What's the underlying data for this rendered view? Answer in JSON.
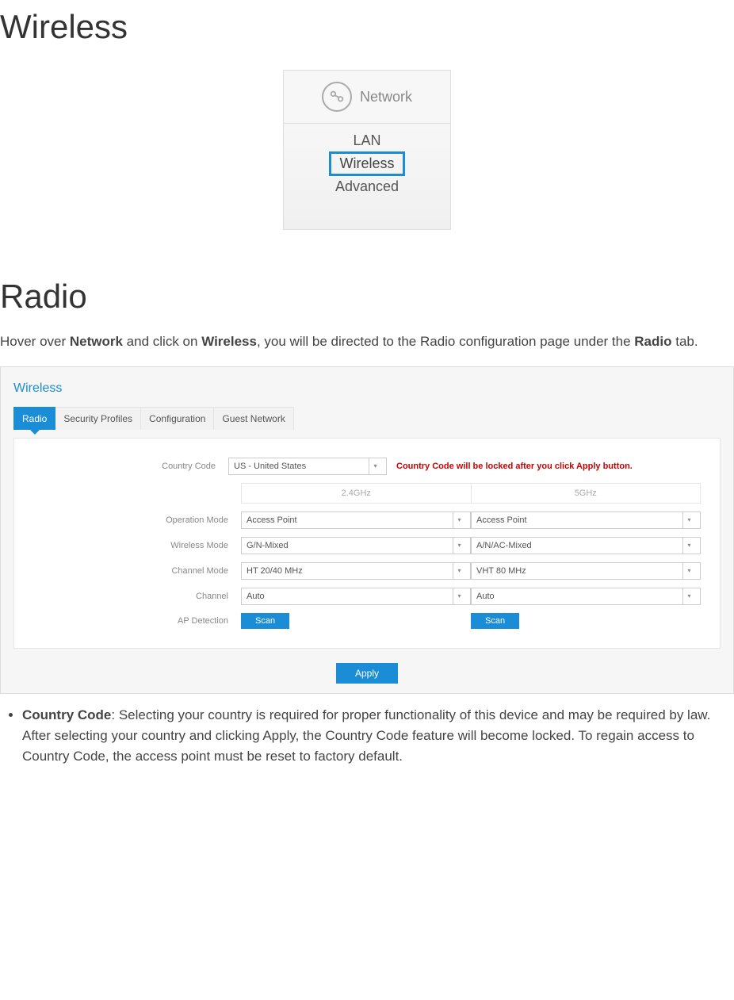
{
  "title_main": "Wireless",
  "nav": {
    "header_label": "Network",
    "items": [
      "LAN",
      "Wireless",
      "Advanced"
    ],
    "highlight_index": 1
  },
  "section_title": "Radio",
  "intro": {
    "pre": "Hover over ",
    "b1": "Network",
    "mid1": " and click on ",
    "b2": "Wireless",
    "mid2": ", you will be directed to the Radio configuration page under the ",
    "b3": "Radio",
    "post": " tab."
  },
  "panel": {
    "title": "Wireless",
    "tabs": [
      "Radio",
      "Security Profiles",
      "Configuration",
      "Guest Network"
    ],
    "active_tab_index": 0,
    "country_label": "Country Code",
    "country_value": "US - United States",
    "country_warning": "Country Code will be locked after you click Apply button.",
    "band_24": "2.4GHz",
    "band_5": "5GHz",
    "labels": {
      "operation_mode": "Operation Mode",
      "wireless_mode": "Wireless Mode",
      "channel_mode": "Channel Mode",
      "channel": "Channel",
      "ap_detection": "AP Detection"
    },
    "col24": {
      "operation_mode": "Access Point",
      "wireless_mode": "G/N-Mixed",
      "channel_mode": "HT 20/40 MHz",
      "channel": "Auto"
    },
    "col5": {
      "operation_mode": "Access Point",
      "wireless_mode": "A/N/AC-Mixed",
      "channel_mode": "VHT 80 MHz",
      "channel": "Auto"
    },
    "scan_label": "Scan",
    "apply_label": "Apply"
  },
  "bullet": {
    "term": "Country Code",
    "desc": ": Selecting your country is required for proper functionality of this device and may be required by law. After selecting your country and clicking Apply, the Country Code feature will become locked. To regain access to Country Code, the access point must be reset to factory default."
  }
}
